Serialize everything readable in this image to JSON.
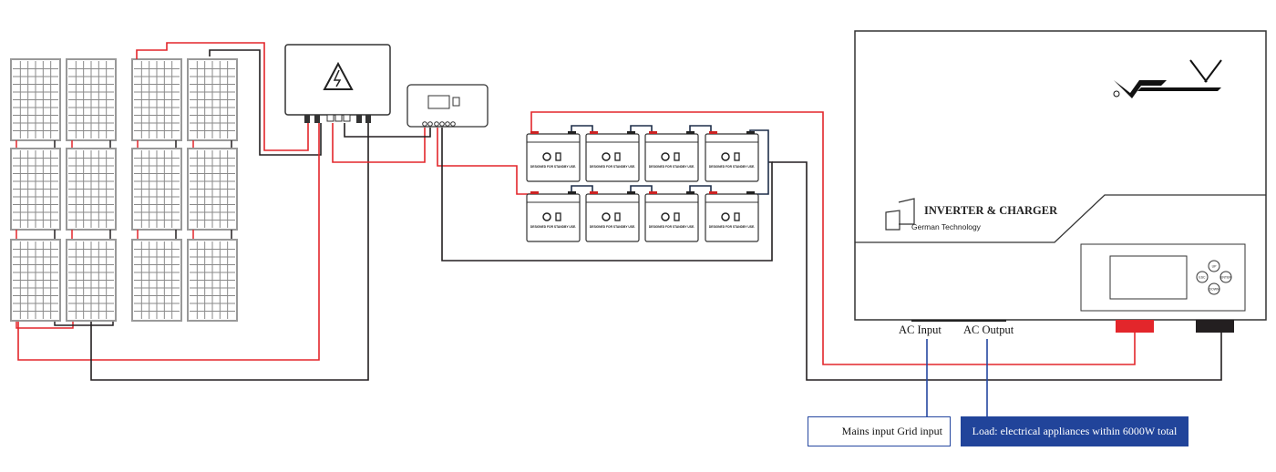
{
  "inverter": {
    "brand_logo": "Vmaxpower",
    "title": "INVERTER & CHARGER",
    "subtitle": "German Technology",
    "buttons": [
      "UP",
      "ESC",
      "ENTER",
      "DOWN"
    ],
    "ac_input_label": "AC Input",
    "ac_output_label": "AC Output"
  },
  "battery": {
    "label": "DESIGNED FOR STANDBY USE.",
    "count": 8
  },
  "solar_array": {
    "rows": 3,
    "columns": 4
  },
  "notes": {
    "mains": "Mains input  Grid input",
    "load": "Load: electrical appliances within  6000W total"
  },
  "colors": {
    "positive_wire": "#e3262b",
    "negative_wire": "#231f20",
    "ac_wire": "#2547a0",
    "note_fill": "#21449a"
  }
}
